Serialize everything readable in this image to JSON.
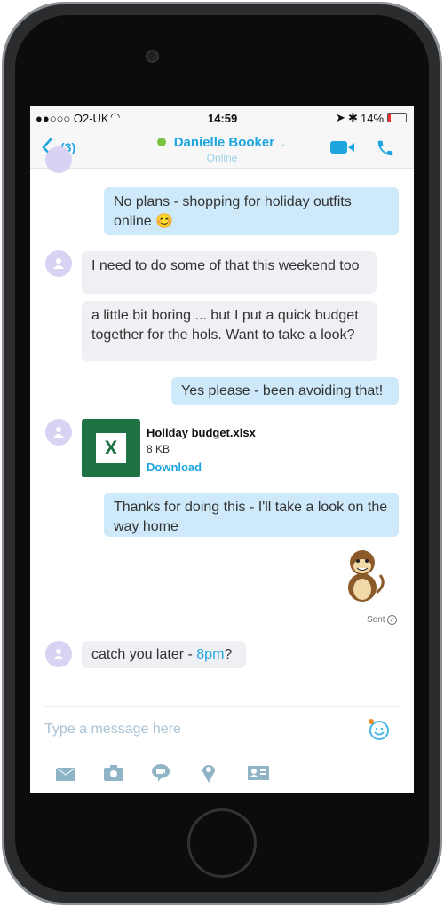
{
  "status_bar": {
    "carrier": "●●○○○ O2-UK",
    "time": "14:59",
    "battery": "14%"
  },
  "header": {
    "back_count": "(3)",
    "contact_name": "Danielle Booker",
    "presence": "Online",
    "presence_color": "#7cc242",
    "accent": "#1ea5e0"
  },
  "messages": [
    {
      "dir": "out",
      "text1": "No plans - shopping for holiday outfits",
      "text2": "online",
      "emoji": "😊"
    },
    {
      "dir": "in",
      "text": "I need to do some of that this weekend too"
    },
    {
      "dir": "in",
      "text": "a little bit boring ... but I put a quick budget together for the hols. Want to take a look?"
    },
    {
      "dir": "out",
      "text": "Yes please - been avoiding that!"
    },
    {
      "dir": "in",
      "file": {
        "name": "Holiday budget.xlsx",
        "size": "8 KB",
        "action": "Download",
        "icon_letter": "X"
      }
    },
    {
      "dir": "out",
      "text": "Thanks for doing this - I'll take a look on the way home"
    },
    {
      "dir": "out",
      "sticker": "monkey-sticker",
      "status": "Sent"
    },
    {
      "dir": "in",
      "text": "catch you later - ",
      "link": "8pm",
      "suffix": "?"
    }
  ],
  "composer": {
    "placeholder": "Type a message here"
  }
}
